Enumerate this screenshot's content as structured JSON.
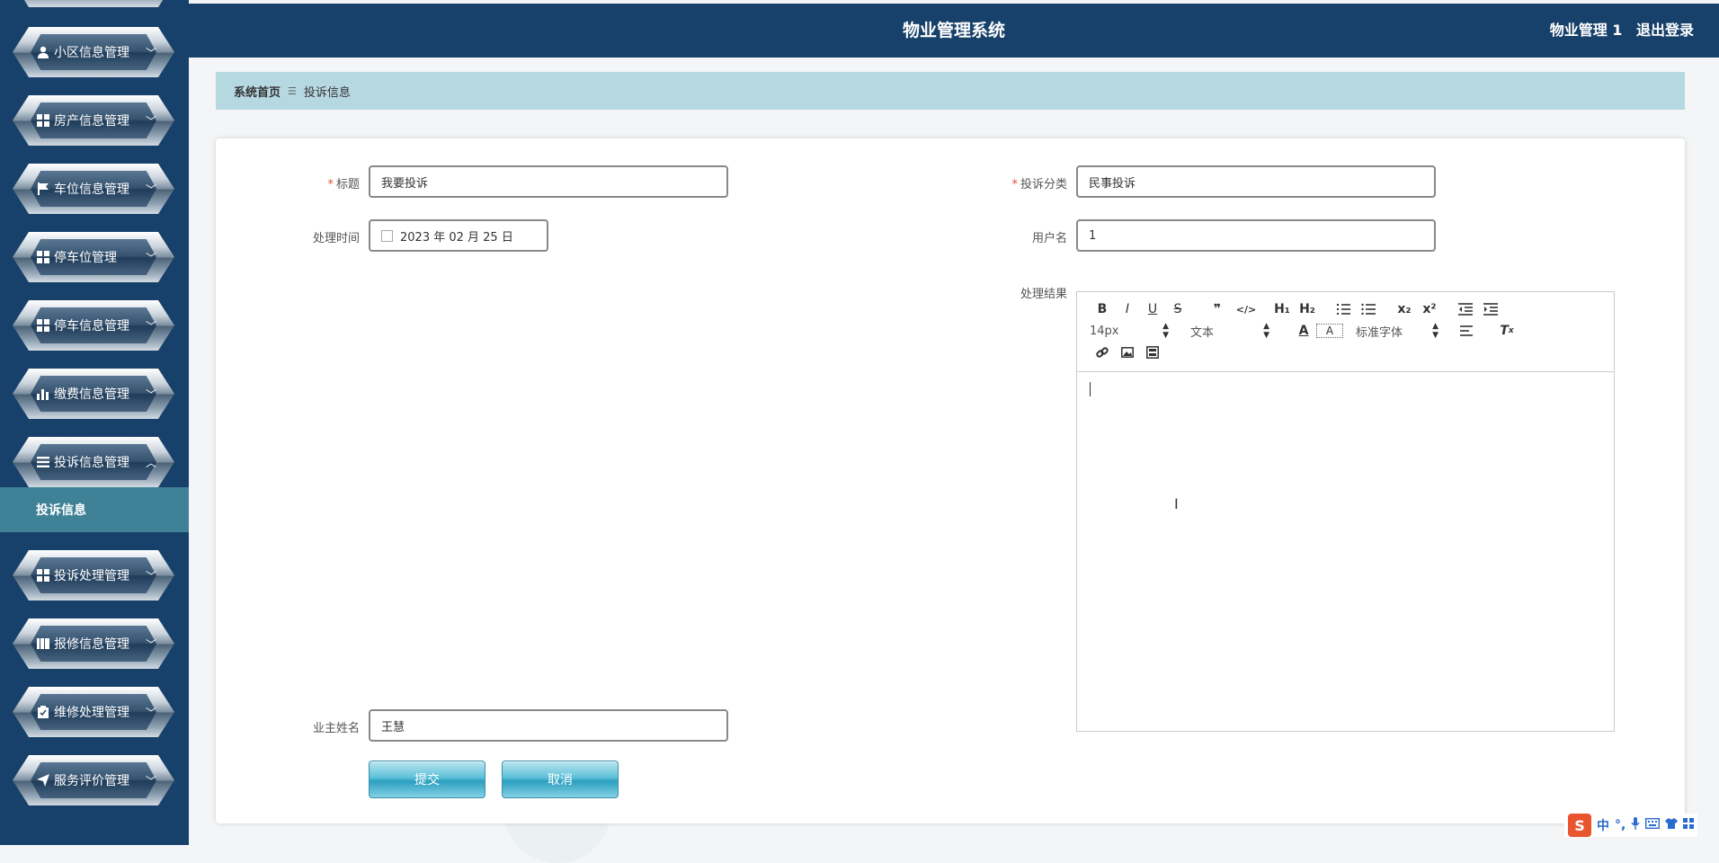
{
  "header": {
    "title": "物业管理系统",
    "user": "物业管理 1",
    "logout": "退出登录"
  },
  "breadcrumb": {
    "home": "系统首页",
    "separator": "☰",
    "current": "投诉信息"
  },
  "sidebar": {
    "items": [
      {
        "label": "小区信息管理",
        "icon": "user-icon",
        "chevron": "﹀"
      },
      {
        "label": "房产信息管理",
        "icon": "grid-icon",
        "chevron": "﹀"
      },
      {
        "label": "车位信息管理",
        "icon": "flag-icon",
        "chevron": "﹀"
      },
      {
        "label": "停车位管理",
        "icon": "grid-icon",
        "chevron": "﹀"
      },
      {
        "label": "停车信息管理",
        "icon": "grid-icon",
        "chevron": "﹀"
      },
      {
        "label": "缴费信息管理",
        "icon": "bar-chart-icon",
        "chevron": "﹀"
      },
      {
        "label": "投诉信息管理",
        "icon": "list-icon",
        "chevron": "︿"
      },
      {
        "label": "投诉处理管理",
        "icon": "grid-icon",
        "chevron": "﹀"
      },
      {
        "label": "报修信息管理",
        "icon": "book-icon",
        "chevron": "﹀"
      },
      {
        "label": "维修处理管理",
        "icon": "clipboard-icon",
        "chevron": "﹀"
      },
      {
        "label": "服务评价管理",
        "icon": "send-icon",
        "chevron": "﹀"
      }
    ],
    "active_sub": "投诉信息"
  },
  "form": {
    "title_label": "标题",
    "title_value": "我要投诉",
    "category_label": "投诉分类",
    "category_value": "民事投诉",
    "time_label": "处理时间",
    "time_value": "2023 年 02 月 25 日",
    "username_label": "用户名",
    "username_value": "1",
    "result_label": "处理结果",
    "owner_label": "业主姓名",
    "owner_value": "王慧",
    "required_mark": "*"
  },
  "editor": {
    "font_size": "14px",
    "block_type": "文本",
    "font_family": "标准字体",
    "tools_row1": [
      "B",
      "I",
      "U",
      "S",
      "❞",
      "</>",
      "H₁",
      "H₂",
      "ordered-list",
      "bullet-list",
      "x₂",
      "x²",
      "outdent",
      "indent"
    ]
  },
  "buttons": {
    "submit": "提交",
    "cancel": "取消"
  },
  "ime": {
    "mode": "中",
    "punct": "°,"
  }
}
